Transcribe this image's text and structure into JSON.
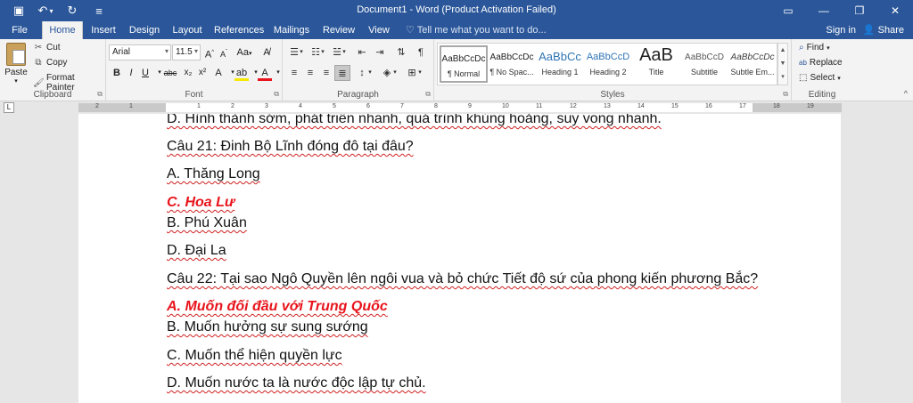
{
  "window": {
    "title": "Document1 - Word (Product Activation Failed)"
  },
  "qat": {
    "save_icon": "save-icon",
    "undo_icon": "undo-icon",
    "redo_icon": "redo-icon",
    "customize_icon": "customize-icon"
  },
  "tabs": [
    {
      "label": "File"
    },
    {
      "label": "Home"
    },
    {
      "label": "Insert"
    },
    {
      "label": "Design"
    },
    {
      "label": "Layout"
    },
    {
      "label": "References"
    },
    {
      "label": "Mailings"
    },
    {
      "label": "Review"
    },
    {
      "label": "View"
    }
  ],
  "active_tab": "Home",
  "tell_me": "Tell me what you want to do...",
  "account": {
    "signin": "Sign in",
    "share": "Share"
  },
  "clipboard": {
    "label": "Clipboard",
    "paste": "Paste",
    "cut": "Cut",
    "copy": "Copy",
    "format_painter": "Format Painter"
  },
  "font": {
    "label": "Font",
    "family": "Arial",
    "size": "11.5",
    "grow": "A",
    "shrink": "A",
    "case": "Aa",
    "bold": "B",
    "italic": "I",
    "underline": "U",
    "strike": "abc",
    "subscript": "x₂",
    "superscript": "x²",
    "font_color": "A"
  },
  "paragraph": {
    "label": "Paragraph"
  },
  "styles": {
    "label": "Styles",
    "items": [
      {
        "sample": "AaBbCcDc",
        "name": "¶ Normal"
      },
      {
        "sample": "AaBbCcDc",
        "name": "¶ No Spac..."
      },
      {
        "sample": "AaBbCc",
        "name": "Heading 1"
      },
      {
        "sample": "AaBbCcD",
        "name": "Heading 2"
      },
      {
        "sample": "AaB",
        "name": "Title"
      },
      {
        "sample": "AaBbCcD",
        "name": "Subtitle"
      },
      {
        "sample": "AaBbCcDc",
        "name": "Subtle Em..."
      }
    ]
  },
  "editing": {
    "label": "Editing",
    "find": "Find",
    "replace": "Replace",
    "select": "Select"
  },
  "ruler": {
    "ticks": [
      "2",
      "1",
      "1",
      "2",
      "3",
      "4",
      "5",
      "6",
      "7",
      "8",
      "9",
      "10",
      "11",
      "12",
      "13",
      "14",
      "15",
      "16",
      "17",
      "18",
      "19"
    ]
  },
  "document": {
    "paragraphs": [
      {
        "text": "D. Hình thành sớm, phát triển nhanh, quá trình khủng hoảng, suy vong nhanh.",
        "answer": false
      },
      {
        "text": "Câu 21: Đinh Bộ Lĩnh đóng đô tại đâu?",
        "answer": false
      },
      {
        "text": "A. Thăng Long",
        "answer": false
      },
      {
        "text": "C. Hoa Lư",
        "answer": true
      },
      {
        "text": "B. Phú Xuân",
        "answer": false
      },
      {
        "text": "D. Đại La",
        "answer": false
      },
      {
        "text": "Câu 22: Tại sao Ngô Quyền lên ngôi vua và bỏ chức Tiết độ sứ của phong kiến phương Bắc?",
        "answer": false
      },
      {
        "text": "A. Muốn đối đầu với Trung Quốc",
        "answer": true
      },
      {
        "text": "B. Muốn hưởng sự sung sướng",
        "answer": false
      },
      {
        "text": "C. Muốn thể hiện quyền lực",
        "answer": false
      },
      {
        "text": "D. Muốn nước ta là nước độc lập tự chủ.",
        "answer": false
      }
    ]
  },
  "colors": {
    "title_bar": "#2b579a",
    "ribbon": "#f3f3f3",
    "answer_red": "#e8141c",
    "workspace": "#e6e6e6"
  }
}
